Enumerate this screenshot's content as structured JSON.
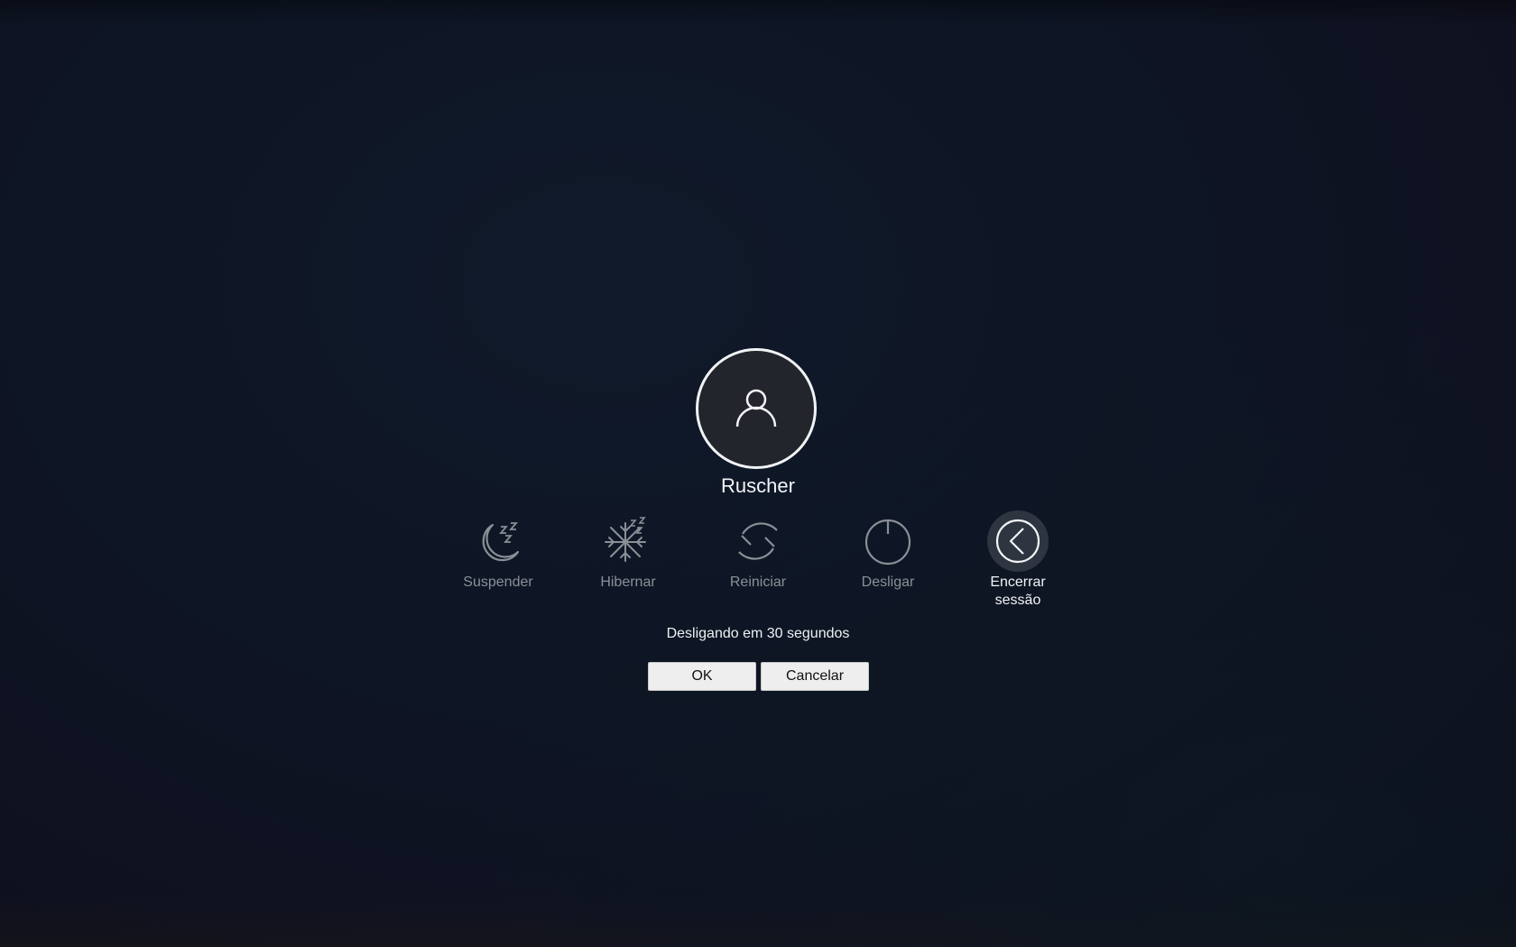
{
  "user": {
    "name": "Ruscher",
    "avatar_icon": "user-icon"
  },
  "actions": [
    {
      "label": "Suspender",
      "icon": "moon-sleep-icon",
      "active": false
    },
    {
      "label": "Hibernar",
      "icon": "snowflake-sleep-icon",
      "active": false
    },
    {
      "label": "Reiniciar",
      "icon": "restart-icon",
      "active": false
    },
    {
      "label": "Desligar",
      "icon": "power-icon",
      "active": false
    },
    {
      "label_line1": "Encerrar",
      "label_line2": "sessão",
      "icon": "logout-arrow-icon",
      "active": true
    }
  ],
  "status_text": "Desligando em 30 segundos",
  "buttons": {
    "ok_label": "OK",
    "cancel_label": "Cancelar"
  },
  "colors": {
    "background": "#0f1322",
    "active_highlight": "#2f3540",
    "inactive_text": "#8b8f96",
    "active_text": "#f2f3f5"
  }
}
